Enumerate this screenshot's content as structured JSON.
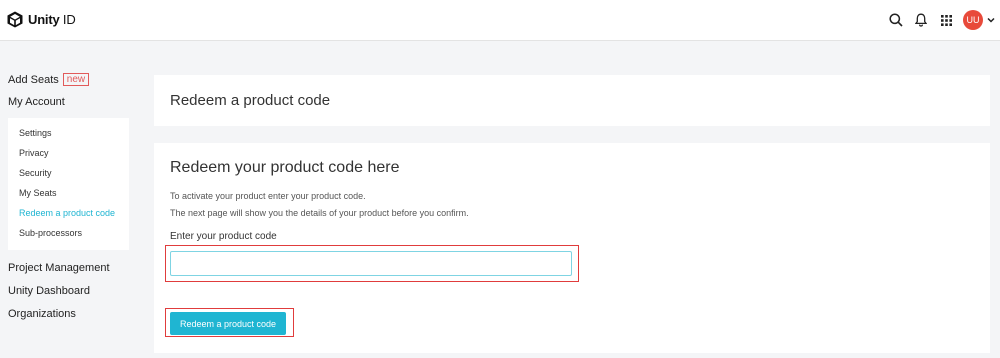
{
  "header": {
    "logo_brand": "Unity",
    "logo_suffix": " ID",
    "avatar_initials": "UU",
    "icons": [
      "search-icon",
      "bell-icon",
      "apps-grid-icon",
      "chevron-down-icon"
    ]
  },
  "sidebar": {
    "add_seats_label": "Add Seats",
    "new_badge": "new",
    "my_account_label": "My Account",
    "submenu": [
      {
        "label": "Settings"
      },
      {
        "label": "Privacy"
      },
      {
        "label": "Security"
      },
      {
        "label": "My Seats"
      },
      {
        "label": "Redeem a product code",
        "active": true
      },
      {
        "label": "Sub-processors"
      }
    ],
    "project_management_label": "Project Management",
    "unity_dashboard_label": "Unity Dashboard",
    "organizations_label": "Organizations"
  },
  "main": {
    "page_title": "Redeem a product code",
    "section_title": "Redeem your product code here",
    "description_line1": "To activate your product enter your product code.",
    "description_line2": "The next page will show you the details of your product before you confirm.",
    "field_label": "Enter your product code",
    "input_value": "",
    "button_label": "Redeem a product code"
  },
  "colors": {
    "accent": "#1fb5d2",
    "highlight": "#e03c3c",
    "avatar_bg": "#e84a3a",
    "page_bg": "#f4f5f7"
  }
}
